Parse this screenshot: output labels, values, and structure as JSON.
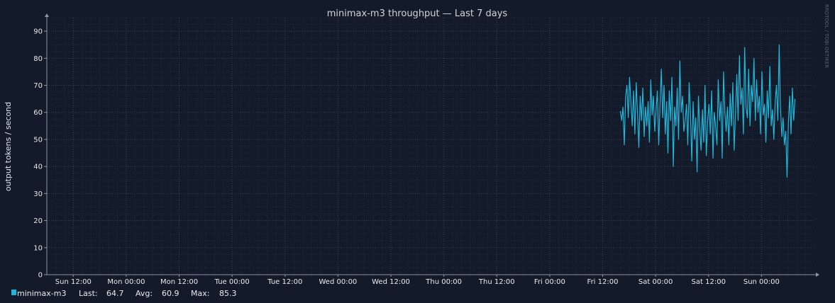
{
  "colors": {
    "background": "#131a29",
    "grid_major": "#3b4455",
    "grid_minor": "#262e3d",
    "axis": "#8e96a8",
    "series": "#1eb8dc"
  },
  "watermark": "RRDTOOL / TOBI OETIKER",
  "chart_data": {
    "type": "line",
    "title": "minimax-m3 throughput — Last 7 days",
    "xlabel": "",
    "ylabel": "output tokens / second",
    "ylim": [
      0,
      95
    ],
    "yticks": [
      "0",
      "10",
      "20",
      "30",
      "40",
      "50",
      "60",
      "70",
      "80",
      "90"
    ],
    "xlim_hours": [
      -6,
      168
    ],
    "xticks": [
      {
        "label": "Sun 12:00",
        "hour": 0
      },
      {
        "label": "Mon 00:00",
        "hour": 12
      },
      {
        "label": "Mon 12:00",
        "hour": 24
      },
      {
        "label": "Tue 00:00",
        "hour": 36
      },
      {
        "label": "Tue 12:00",
        "hour": 48
      },
      {
        "label": "Wed 00:00",
        "hour": 60
      },
      {
        "label": "Wed 12:00",
        "hour": 72
      },
      {
        "label": "Thu 00:00",
        "hour": 84
      },
      {
        "label": "Thu 12:00",
        "hour": 96
      },
      {
        "label": "Fri 00:00",
        "hour": 108
      },
      {
        "label": "Fri 12:00",
        "hour": 120
      },
      {
        "label": "Sat 00:00",
        "hour": 132
      },
      {
        "label": "Sat 12:00",
        "hour": 144
      },
      {
        "label": "Sun 00:00",
        "hour": 156
      }
    ],
    "grid": true,
    "legend": "bottom-left",
    "series": [
      {
        "name": "minimax-m3",
        "color": "#1eb8dc",
        "x_hours": [
          124,
          124.3,
          124.6,
          124.9,
          125.2,
          125.5,
          125.8,
          126.1,
          126.4,
          126.7,
          127,
          127.3,
          127.6,
          127.9,
          128.2,
          128.5,
          128.8,
          129.1,
          129.4,
          129.7,
          130,
          130.3,
          130.6,
          130.9,
          131.2,
          131.5,
          131.8,
          132.1,
          132.4,
          132.7,
          133,
          133.3,
          133.6,
          133.9,
          134.2,
          134.5,
          134.8,
          135.1,
          135.4,
          135.7,
          136,
          136.3,
          136.6,
          136.9,
          137.2,
          137.5,
          137.8,
          138.1,
          138.4,
          138.7,
          139,
          139.3,
          139.6,
          139.9,
          140.2,
          140.5,
          140.8,
          141.1,
          141.4,
          141.7,
          142,
          142.3,
          142.6,
          142.9,
          143.2,
          143.5,
          143.8,
          144.1,
          144.4,
          144.7,
          145,
          145.3,
          145.6,
          145.9,
          146.2,
          146.5,
          146.8,
          147.1,
          147.4,
          147.7,
          148,
          148.3,
          148.6,
          148.9,
          149.2,
          149.5,
          149.8,
          150.1,
          150.4,
          150.7,
          151,
          151.3,
          151.6,
          151.9,
          152.2,
          152.5,
          152.8,
          153.1,
          153.4,
          153.7,
          154,
          154.3,
          154.6,
          154.9,
          155.2,
          155.5,
          155.8,
          156.1,
          156.4,
          156.7,
          157,
          157.3,
          157.6,
          157.9,
          158.2,
          158.5,
          158.8,
          159.1,
          159.4,
          159.7,
          160,
          160.3,
          160.6,
          160.9,
          161.2,
          161.5,
          161.8,
          162.1,
          162.4,
          162.7,
          163,
          163.3,
          163.6
        ],
        "values": [
          60.5,
          57,
          62,
          48,
          66,
          70,
          58,
          73,
          64,
          55,
          68,
          52,
          71,
          60,
          47,
          66,
          57,
          69,
          51,
          62,
          55,
          64,
          49,
          72,
          59,
          66,
          53,
          61,
          68,
          48,
          63,
          76,
          58,
          70,
          52,
          64,
          45,
          68,
          57,
          73,
          40,
          62,
          55,
          69,
          50,
          79,
          60,
          66,
          53,
          57,
          63,
          48,
          71,
          59,
          42,
          64,
          50,
          58,
          38,
          66,
          54,
          46,
          61,
          49,
          70,
          44,
          57,
          63,
          52,
          68,
          43,
          60,
          55,
          48,
          72,
          57,
          64,
          43,
          75,
          60,
          53,
          62,
          48,
          67,
          55,
          71,
          46,
          59,
          74,
          57,
          81,
          63,
          69,
          52,
          84,
          62,
          58,
          76,
          55,
          70,
          64,
          80,
          57,
          72,
          60,
          66,
          52,
          75,
          59,
          63,
          49,
          68,
          58,
          77,
          55,
          61,
          50,
          64,
          70,
          57,
          85,
          62,
          51,
          58,
          48,
          53,
          36,
          56,
          66,
          52,
          69,
          57,
          65,
          52,
          64.7
        ]
      }
    ]
  },
  "legend": {
    "series_name": "minimax-m3",
    "last_label": "Last:",
    "last_value": "64.7",
    "avg_label": "Avg:",
    "avg_value": "60.9",
    "max_label": "Max:",
    "max_value": "85.3"
  }
}
